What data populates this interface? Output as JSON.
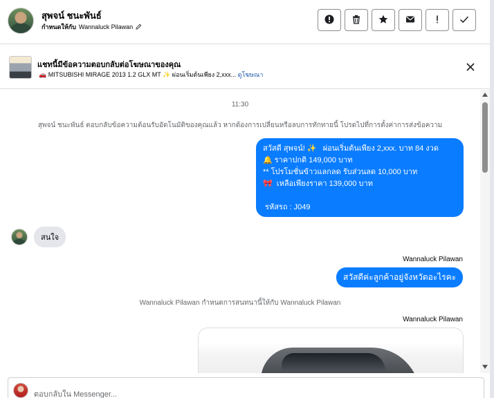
{
  "header": {
    "contact_name": "สุพจน์ ชนะพันธ์",
    "assigned_label": "กำหนดให้กับ",
    "assigned_to": "Wannaluck Pilawan",
    "edit_icon": "pencil-icon",
    "actions": [
      {
        "name": "report-button",
        "icon": "exclamation-circle-icon"
      },
      {
        "name": "delete-button",
        "icon": "trash-icon"
      },
      {
        "name": "star-button",
        "icon": "star-icon"
      },
      {
        "name": "mark-unread-button",
        "icon": "envelope-icon"
      },
      {
        "name": "spam-button",
        "icon": "exclamation-icon"
      },
      {
        "name": "mark-done-button",
        "icon": "check-icon"
      }
    ]
  },
  "ad_banner": {
    "title": "แชทนี้มีข้อความตอบกลับต่อโฆษณาของคุณ",
    "subtitle": "🚗 MITSUBISHI MIRAGE 2013 1.2 GLX MT ✨ ผ่อนเริ่มต้นเพียง 2,xxx...",
    "link": "ดูโฆษณา",
    "close_icon": "close-icon"
  },
  "thread": {
    "time": "11:30",
    "auto_reply_notice": "สุพจน์ ชนะพันธ์ ตอบกลับข้อความต้อนรับอัตโนมัติของคุณแล้ว หากต้องการเปลี่ยนหรือลบการทักทายนี้ โปรดไปที่การตั้งค่าการส่งข้อความ",
    "outgoing_1": {
      "lines": [
        "สวัสดี สุพจน์! ✨   ผ่อนเริ่มต้นเพียง 2,xxx. บาท 84 งวด",
        "🔔 ราคาปกติ 149,000 บาท",
        "** โปรโมชั่นข้าวแลกลด รับส่วนลด 10,000 บาท",
        "🎀  เหลือเพียงราคา 139,000 บาท",
        "",
        " รหัสรถ : J049"
      ]
    },
    "incoming_1": "สนใจ",
    "sender_1": "Wannaluck Pilawan",
    "outgoing_2": "สวัสดีค่ะลูกค้าอยู่จังหวัดอะไรคะ",
    "assign_notice": "Wannaluck Pilawan กำหนดการสนทนานี้ให้กับ Wannaluck Pilawan",
    "sender_2": "Wannaluck Pilawan",
    "image_alt": "car-photo"
  },
  "composer": {
    "placeholder": "ตอบกลับใน Messenger..."
  },
  "colors": {
    "outgoing_bubble": "#0a7cff",
    "incoming_bubble": "#e4e6eb",
    "link": "#1a56a8"
  }
}
